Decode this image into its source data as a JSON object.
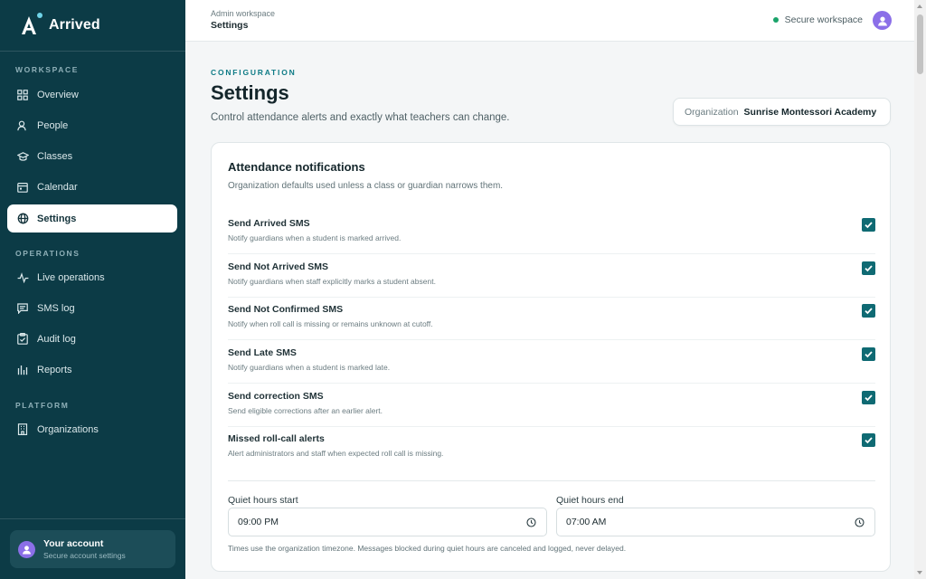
{
  "app": {
    "name": "Arrived"
  },
  "sidebar": {
    "sections": [
      {
        "label": "WORKSPACE"
      },
      {
        "label": "OPERATIONS"
      },
      {
        "label": "PLATFORM"
      }
    ],
    "items": [
      {
        "label": "Overview",
        "icon": "grid-icon"
      },
      {
        "label": "People",
        "icon": "person-icon"
      },
      {
        "label": "Classes",
        "icon": "graduation-cap-icon"
      },
      {
        "label": "Calendar",
        "icon": "calendar-icon"
      },
      {
        "label": "Settings",
        "icon": "settings-icon",
        "active": true
      },
      {
        "label": "Live operations",
        "icon": "activity-icon"
      },
      {
        "label": "SMS log",
        "icon": "message-icon"
      },
      {
        "label": "Audit log",
        "icon": "clipboard-icon"
      },
      {
        "label": "Reports",
        "icon": "bar-chart-icon"
      },
      {
        "label": "Organizations",
        "icon": "building-icon"
      }
    ],
    "account": {
      "title": "Your account",
      "subtitle": "Secure account settings"
    }
  },
  "topbar": {
    "breadcrumb_parent": "Admin workspace",
    "breadcrumb_current": "Settings",
    "status": "Secure workspace"
  },
  "main": {
    "eyebrow": "CONFIGURATION",
    "title": "Settings",
    "subtitle": "Control attendance alerts and exactly what teachers can change.",
    "organization": {
      "label": "Organization",
      "value": "Sunrise Montessori Academy"
    }
  },
  "notifications": {
    "title": "Attendance notifications",
    "subtitle": "Organization defaults used unless a class or guardian narrows them.",
    "items": [
      {
        "title": "Send Arrived SMS",
        "description": "Notify guardians when a student is marked arrived.",
        "checked": true
      },
      {
        "title": "Send Not Arrived SMS",
        "description": "Notify guardians when staff explicitly marks a student absent.",
        "checked": true
      },
      {
        "title": "Send Not Confirmed SMS",
        "description": "Notify when roll call is missing or remains unknown at cutoff.",
        "checked": true
      },
      {
        "title": "Send Late SMS",
        "description": "Notify guardians when a student is marked late.",
        "checked": true
      },
      {
        "title": "Send correction SMS",
        "description": "Send eligible corrections after an earlier alert.",
        "checked": true
      },
      {
        "title": "Missed roll-call alerts",
        "description": "Alert administrators and staff when expected roll call is missing.",
        "checked": true
      }
    ],
    "quiet_start": {
      "label": "Quiet hours start",
      "value": "09:00 PM"
    },
    "quiet_end": {
      "label": "Quiet hours end",
      "value": "07:00 AM"
    },
    "note": "Times use the organization timezone. Messages blocked during quiet hours are canceled and logged, never delayed."
  },
  "colors": {
    "sidebar_bg": "#0c3b46",
    "accent": "#0f6a73",
    "eyebrow": "#0e7b86",
    "status_green": "#1aa36a",
    "avatar": "#8b6fe8"
  }
}
